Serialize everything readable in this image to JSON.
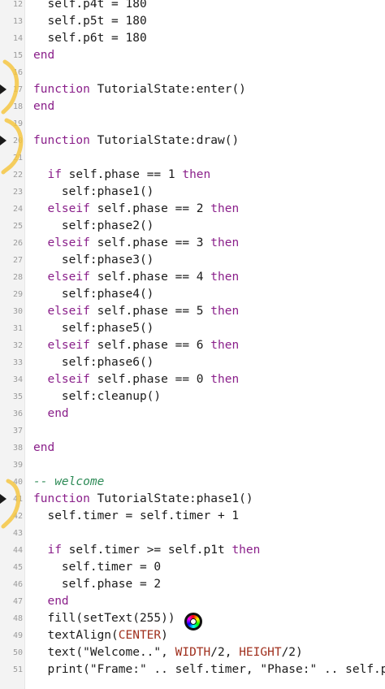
{
  "lines": [
    {
      "n": "12",
      "code": "  self.p4t = 180"
    },
    {
      "n": "13",
      "code": "  self.p5t = 180"
    },
    {
      "n": "14",
      "code": "  self.p6t = 180"
    },
    {
      "n": "15",
      "code": "end"
    },
    {
      "n": "16",
      "code": ""
    },
    {
      "n": "17",
      "code": "function TutorialState:enter()"
    },
    {
      "n": "18",
      "code": "end"
    },
    {
      "n": "19",
      "code": ""
    },
    {
      "n": "20",
      "code": "function TutorialState:draw()"
    },
    {
      "n": "21",
      "code": ""
    },
    {
      "n": "22",
      "code": "  if self.phase == 1 then"
    },
    {
      "n": "23",
      "code": "    self:phase1()"
    },
    {
      "n": "24",
      "code": "  elseif self.phase == 2 then"
    },
    {
      "n": "25",
      "code": "    self:phase2()"
    },
    {
      "n": "26",
      "code": "  elseif self.phase == 3 then"
    },
    {
      "n": "27",
      "code": "    self:phase3()"
    },
    {
      "n": "28",
      "code": "  elseif self.phase == 4 then"
    },
    {
      "n": "29",
      "code": "    self:phase4()"
    },
    {
      "n": "30",
      "code": "  elseif self.phase == 5 then"
    },
    {
      "n": "31",
      "code": "    self:phase5()"
    },
    {
      "n": "32",
      "code": "  elseif self.phase == 6 then"
    },
    {
      "n": "33",
      "code": "    self:phase6()"
    },
    {
      "n": "34",
      "code": "  elseif self.phase == 0 then"
    },
    {
      "n": "35",
      "code": "    self:cleanup()"
    },
    {
      "n": "36",
      "code": "  end"
    },
    {
      "n": "37",
      "code": ""
    },
    {
      "n": "38",
      "code": "end"
    },
    {
      "n": "39",
      "code": ""
    },
    {
      "n": "40",
      "code": "-- welcome"
    },
    {
      "n": "41",
      "code": "function TutorialState:phase1()"
    },
    {
      "n": "42",
      "code": "  self.timer = self.timer + 1"
    },
    {
      "n": "43",
      "code": ""
    },
    {
      "n": "44",
      "code": "  if self.timer >= self.p1t then"
    },
    {
      "n": "45",
      "code": "    self.timer = 0"
    },
    {
      "n": "46",
      "code": "    self.phase = 2"
    },
    {
      "n": "47",
      "code": "  end"
    },
    {
      "n": "48",
      "code": "  fill(setText(255))"
    },
    {
      "n": "49",
      "code": "  textAlign(CENTER)"
    },
    {
      "n": "50",
      "code": "  text(\"Welcome..\", WIDTH/2, HEIGHT/2)"
    },
    {
      "n": "51",
      "code": "  print(\"Frame:\" .. self.timer, \"Phase:\" .. self.p"
    }
  ],
  "markers": [
    "17",
    "20",
    "41"
  ],
  "keywords": [
    "function",
    "elseif",
    "then",
    "end",
    "if"
  ],
  "constants": [
    "CENTER",
    "WIDTH",
    "HEIGHT"
  ],
  "colors": {
    "keyword": "#8a1f8a",
    "comment": "#2e8b57",
    "constant": "#a0301e",
    "text": "#1a1a1a",
    "line_number": "#9b9b9b",
    "highlight": "#f5c542"
  },
  "color_picker_icon": "color-wheel-icon"
}
